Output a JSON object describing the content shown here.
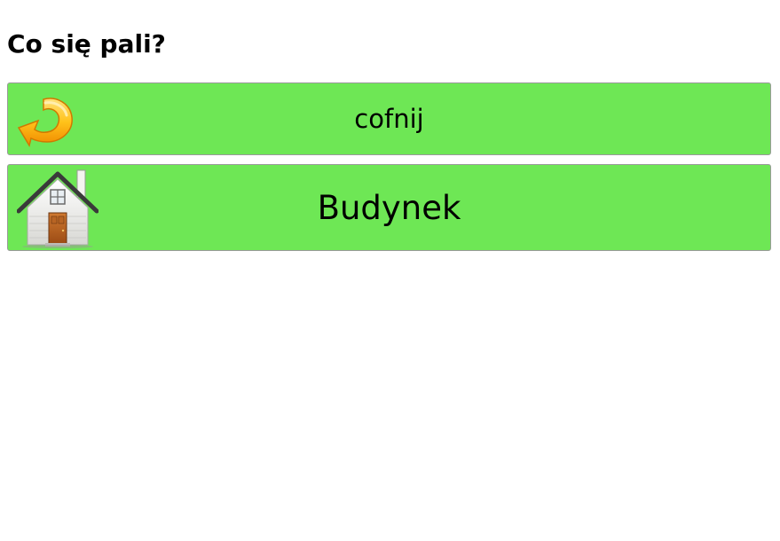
{
  "page": {
    "question": "Co się pali?"
  },
  "choices": [
    {
      "label": "cofnij",
      "icon": "undo-arrow-icon"
    },
    {
      "label": "Budynek",
      "icon": "house-icon"
    }
  ],
  "colors": {
    "button_bg": "#6ee755",
    "button_border": "#9a9a9a",
    "text": "#000000",
    "background": "#ffffff"
  }
}
